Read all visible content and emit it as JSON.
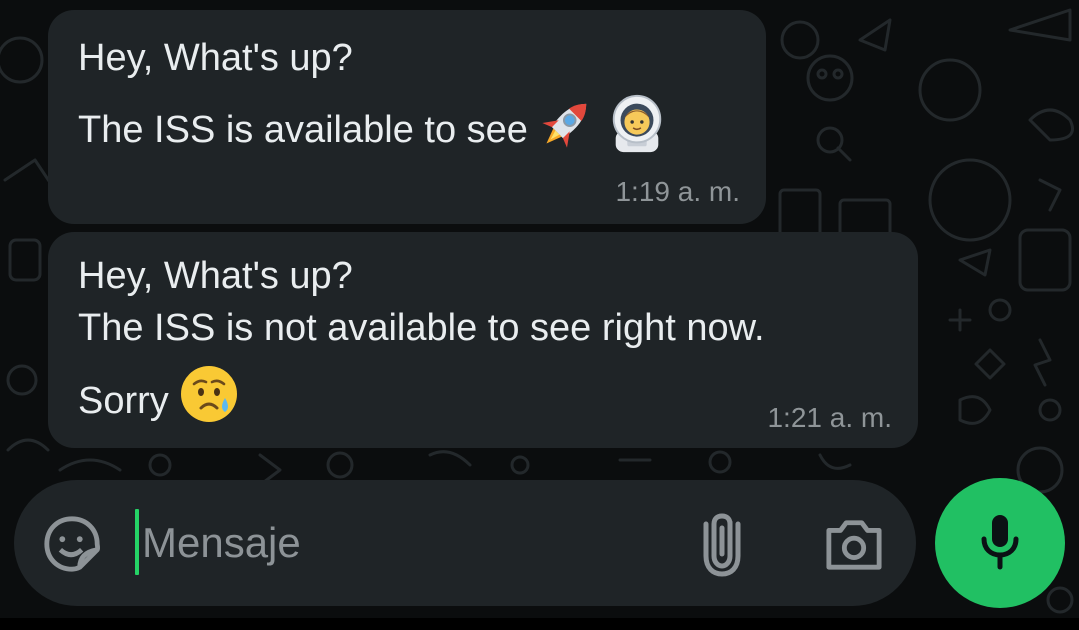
{
  "messages": [
    {
      "lines": [
        "Hey, What's up?",
        "The ISS is available to see"
      ],
      "emojis": [
        "rocket-emoji",
        "astronaut-emoji"
      ],
      "time": "1:19 a. m."
    },
    {
      "lines": [
        "Hey, What's up?",
        "The ISS is not available to see right now.",
        "Sorry"
      ],
      "emojis": [
        "sad-relieved-face-emoji"
      ],
      "time": "1:21 a. m."
    }
  ],
  "composer": {
    "placeholder": "Mensaje",
    "icons": [
      "sticker-icon",
      "paperclip-icon",
      "camera-icon",
      "microphone-icon"
    ]
  },
  "colors": {
    "background": "#0b0d0e",
    "bubble": "#1f2427",
    "text": "#e9edef",
    "timestamp": "#8f9598",
    "accent": "#21c063"
  }
}
